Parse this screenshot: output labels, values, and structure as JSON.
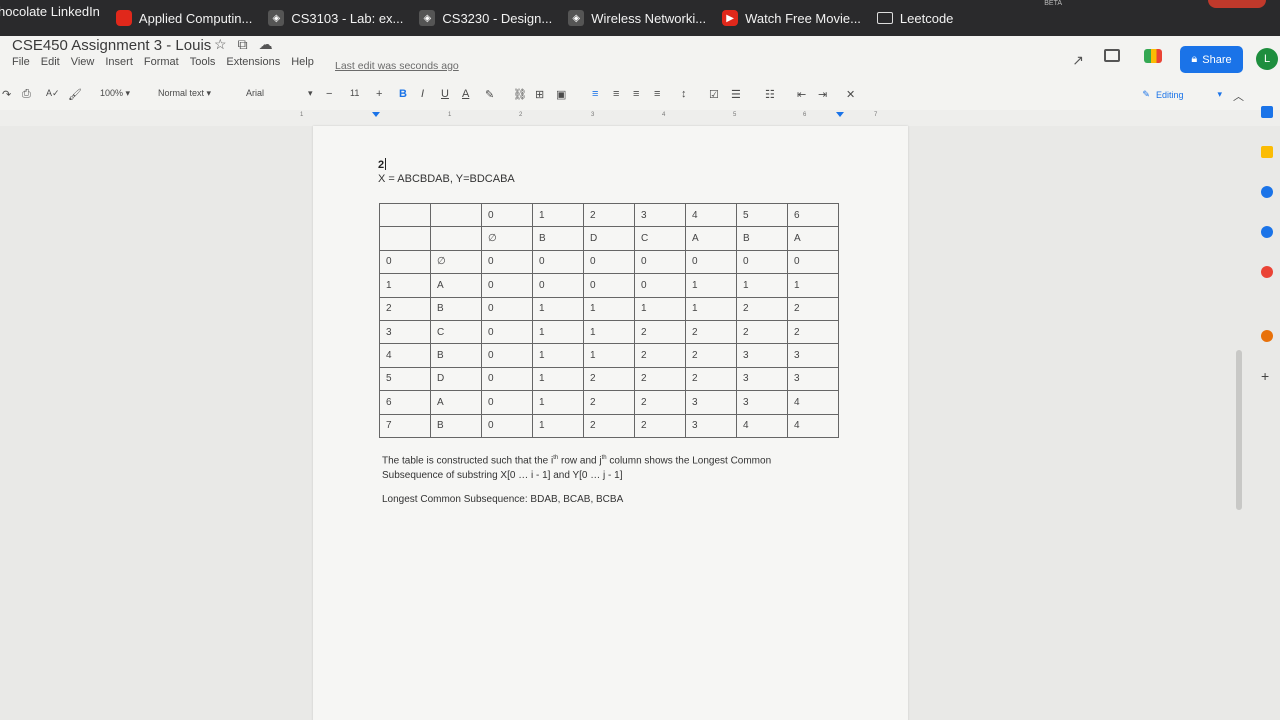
{
  "bookmarks": [
    {
      "label": "hocolate LinkedIn",
      "icon": "none"
    },
    {
      "label": "Applied Computin...",
      "icon": "bookmark-icon"
    },
    {
      "label": "CS3103 - Lab: ex...",
      "icon": "bookmark-icon"
    },
    {
      "label": "CS3230 - Design...",
      "icon": "bookmark-icon"
    },
    {
      "label": "Wireless Networki...",
      "icon": "bookmark-icon"
    },
    {
      "label": "Watch Free Movie...",
      "icon": "play-icon"
    },
    {
      "label": "Leetcode",
      "icon": "folder-icon"
    }
  ],
  "beta_label": "BETA",
  "doc": {
    "title": "CSE450 Assignment 3 - Louis",
    "menu": [
      "File",
      "Edit",
      "View",
      "Insert",
      "Format",
      "Tools",
      "Extensions",
      "Help"
    ],
    "last_edit": "Last edit was seconds ago",
    "share_label": "Share",
    "avatar_letter": "L"
  },
  "toolbar": {
    "zoom": "100%",
    "style": "Normal text",
    "font": "Arial",
    "font_size": "11",
    "mode": "Editing"
  },
  "ruler": [
    "1",
    "1",
    "2",
    "3",
    "4",
    "5",
    "6",
    "7"
  ],
  "content": {
    "heading": "2",
    "strings": "X = ABCBDAB, Y=BDCABA",
    "table": [
      [
        "",
        "",
        "0",
        "1",
        "2",
        "3",
        "4",
        "5",
        "6"
      ],
      [
        "",
        "",
        "∅",
        "B",
        "D",
        "C",
        "A",
        "B",
        "A"
      ],
      [
        "0",
        "∅",
        "0",
        "0",
        "0",
        "0",
        "0",
        "0",
        "0"
      ],
      [
        "1",
        "A",
        "0",
        "0",
        "0",
        "0",
        "1",
        "1",
        "1"
      ],
      [
        "2",
        "B",
        "0",
        "1",
        "1",
        "1",
        "1",
        "2",
        "2"
      ],
      [
        "3",
        "C",
        "0",
        "1",
        "1",
        "2",
        "2",
        "2",
        "2"
      ],
      [
        "4",
        "B",
        "0",
        "1",
        "1",
        "2",
        "2",
        "3",
        "3"
      ],
      [
        "5",
        "D",
        "0",
        "1",
        "2",
        "2",
        "2",
        "3",
        "3"
      ],
      [
        "6",
        "A",
        "0",
        "1",
        "2",
        "2",
        "3",
        "3",
        "4"
      ],
      [
        "7",
        "B",
        "0",
        "1",
        "2",
        "2",
        "3",
        "4",
        "4"
      ]
    ],
    "explanation_1": "The table is constructed such that the i",
    "explanation_sup_i": "th",
    "explanation_2": " row and j",
    "explanation_sup_j": "th",
    "explanation_3": " column shows the Longest Common Subsequence of substring X[0 … i - 1] and Y[0 … j - 1]",
    "answer": "Longest Common Subsequence: BDAB, BCAB, BCBA"
  },
  "colors": {
    "accent": "#1a73e8",
    "avatar": "#1e8e3e",
    "bookmarks_bg": "#2a2a2c"
  }
}
